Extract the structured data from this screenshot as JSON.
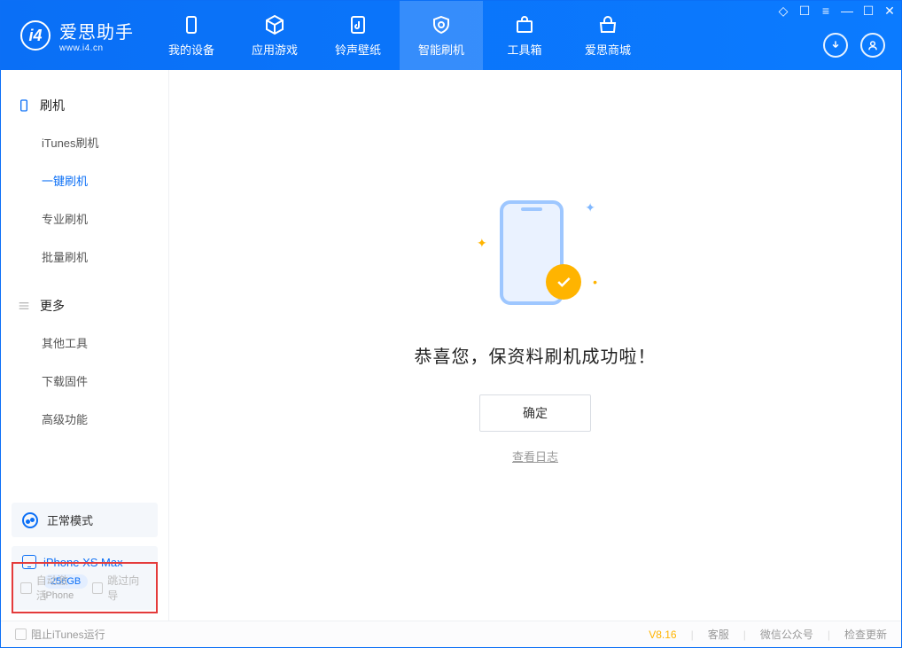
{
  "app": {
    "title": "爱思助手",
    "subtitle": "www.i4.cn"
  },
  "nav": {
    "items": [
      {
        "label": "我的设备"
      },
      {
        "label": "应用游戏"
      },
      {
        "label": "铃声壁纸"
      },
      {
        "label": "智能刷机"
      },
      {
        "label": "工具箱"
      },
      {
        "label": "爱思商城"
      }
    ],
    "activeIndex": 3
  },
  "sidebar": {
    "sections": [
      {
        "title": "刷机",
        "items": [
          "iTunes刷机",
          "一键刷机",
          "专业刷机",
          "批量刷机"
        ],
        "activeIndex": 1
      },
      {
        "title": "更多",
        "items": [
          "其他工具",
          "下载固件",
          "高级功能"
        ]
      }
    ],
    "mode": "正常模式",
    "device": {
      "name": "iPhone XS Max",
      "storage": "256GB",
      "type": "iPhone"
    },
    "checkboxes": {
      "autoActivate": "自动激活",
      "skipGuide": "跳过向导"
    }
  },
  "main": {
    "successText": "恭喜您，保资料刷机成功啦！",
    "okButton": "确定",
    "logLink": "查看日志"
  },
  "footer": {
    "blockItunes": "阻止iTunes运行",
    "version": "V8.16",
    "links": [
      "客服",
      "微信公众号",
      "检查更新"
    ]
  }
}
